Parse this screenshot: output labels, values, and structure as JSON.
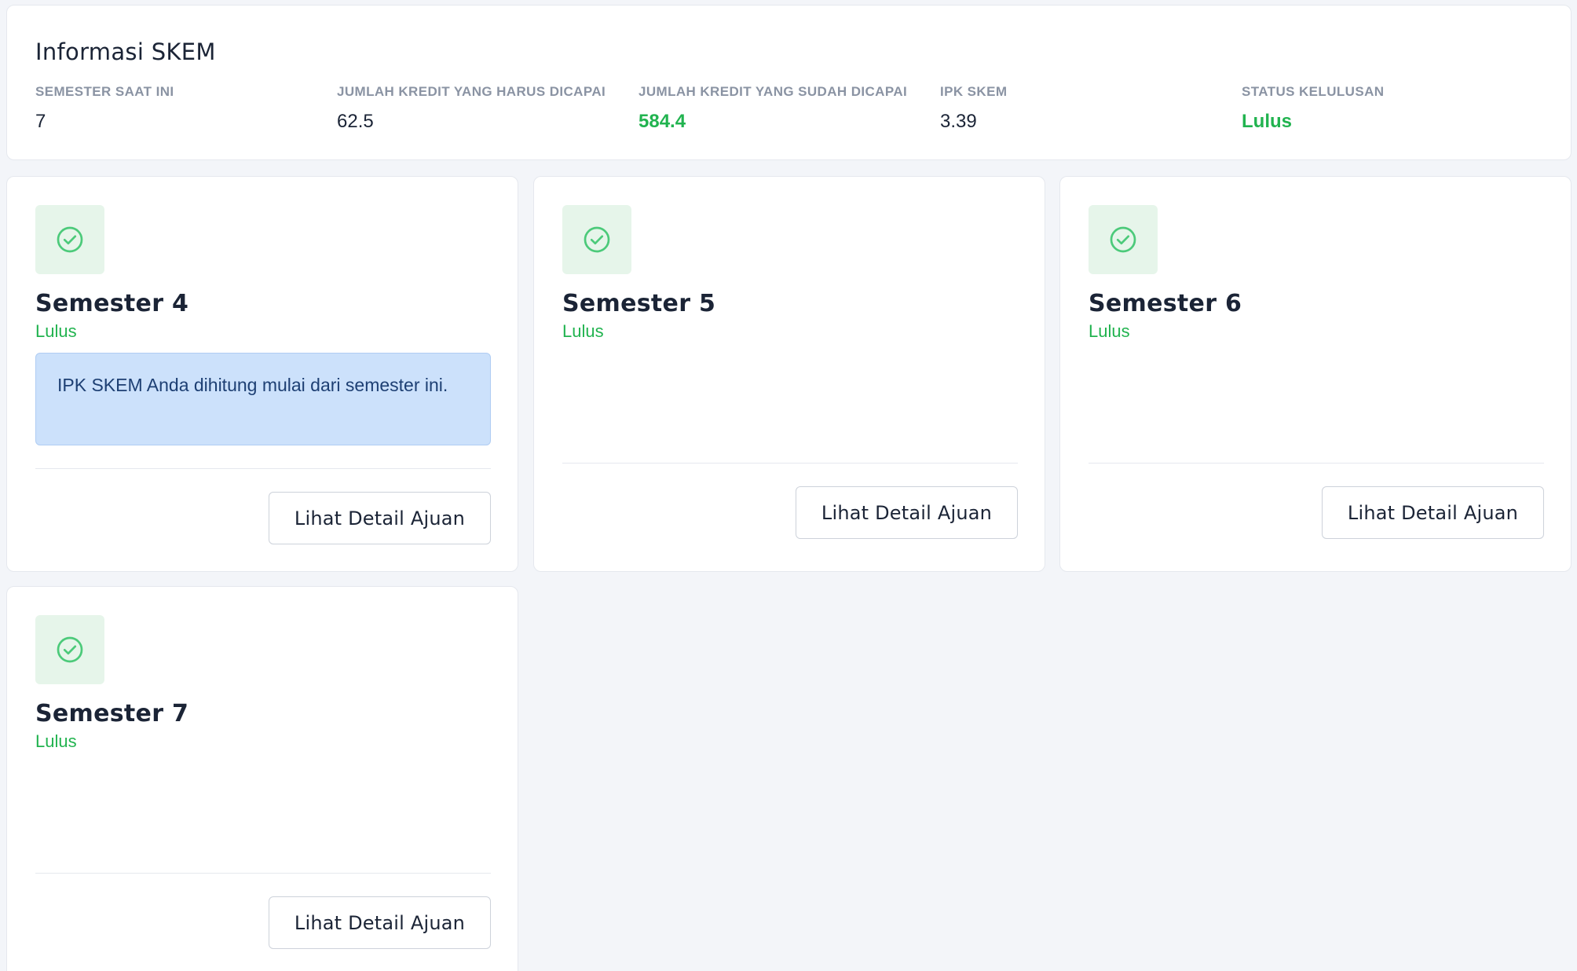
{
  "info": {
    "title": "Informasi SKEM",
    "stats": [
      {
        "label": "SEMESTER SAAT INI",
        "value": "7",
        "highlight": false
      },
      {
        "label": "JUMLAH KREDIT YANG HARUS DICAPAI",
        "value": "62.5",
        "highlight": false
      },
      {
        "label": "JUMLAH KREDIT YANG SUDAH DICAPAI",
        "value": "584.4",
        "highlight": true
      },
      {
        "label": "IPK SKEM",
        "value": "3.39",
        "highlight": false
      },
      {
        "label": "STATUS KELULUSAN",
        "value": "Lulus",
        "highlight": true
      }
    ]
  },
  "semesters": [
    {
      "title": "Semester 4",
      "status": "Lulus",
      "icon": "check-circle-icon",
      "notice": "IPK SKEM Anda dihitung mulai dari semester ini.",
      "button_label": "Lihat Detail Ajuan"
    },
    {
      "title": "Semester 5",
      "status": "Lulus",
      "icon": "check-circle-icon",
      "button_label": "Lihat Detail Ajuan"
    },
    {
      "title": "Semester 6",
      "status": "Lulus",
      "icon": "check-circle-icon",
      "button_label": "Lihat Detail Ajuan"
    },
    {
      "title": "Semester 7",
      "status": "Lulus",
      "icon": "check-circle-icon",
      "button_label": "Lihat Detail Ajuan"
    }
  ],
  "colors": {
    "success": "#21b34f",
    "notice_bg": "#cce1fb",
    "notice_text": "#1d3f73",
    "page_bg": "#f3f5f9"
  }
}
